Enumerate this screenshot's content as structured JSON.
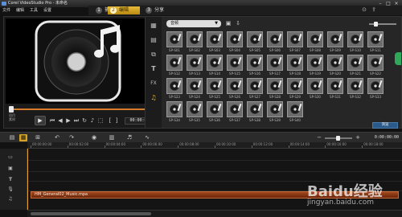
{
  "app": {
    "title": "Corel VideoStudio Pro - 未命名"
  },
  "window_controls": [
    "–",
    "□",
    "×"
  ],
  "menu": [
    "文件",
    "编辑",
    "工具",
    "设置"
  ],
  "steps": [
    {
      "num": "1",
      "label": "捕获",
      "active": false
    },
    {
      "num": "2",
      "label": "编辑",
      "active": true
    },
    {
      "num": "3",
      "label": "分享",
      "active": false
    }
  ],
  "player": {
    "mode_labels": [
      "项目",
      "素材"
    ],
    "timecode": "00:00:00:00"
  },
  "library": {
    "category_dropdown": "音频",
    "browse_button": "浏览",
    "sidebar_icons": [
      "media-icon",
      "instant-project-icon",
      "transition-icon",
      "title-icon",
      "fx-filter-icon",
      "audio-note-icon"
    ],
    "items": [
      "SP-S01",
      "SP-S02",
      "SP-S03",
      "SP-S04",
      "SP-S05",
      "SP-S06",
      "SP-S07",
      "SP-S08",
      "SP-S09",
      "SP-S10",
      "SP-S11",
      "SP-S12",
      "SP-S13",
      "SP-S14",
      "SP-S15",
      "SP-S16",
      "SP-S17",
      "SP-S18",
      "SP-S19",
      "SP-S20",
      "SP-S21",
      "SP-S22",
      "SP-S23",
      "SP-S24",
      "SP-S25",
      "SP-S26",
      "SP-S27",
      "SP-S28",
      "SP-S29",
      "SP-S30",
      "SP-S31",
      "SP-S32",
      "SP-S33",
      "SP-S34",
      "SP-S35",
      "SP-S36",
      "SP-S37",
      "SP-S38",
      "SP-S39",
      "SP-S40"
    ]
  },
  "timeline": {
    "tooltip": "混音器",
    "timecode": "0:00:00:00",
    "ruler": [
      "00:00:00:00",
      "00:00:02:00",
      "00:00:04:00",
      "00:00:06:00",
      "00:00:08:00",
      "00:00:10:00",
      "00:00:12:00",
      "00:00:14:00",
      "00:00:16:00",
      "00:00:18:00"
    ],
    "music_clip": "HM_General02_Music.mpa"
  },
  "watermark": {
    "logo": "Baidu经验",
    "url": "jingyan.baidu.com"
  }
}
